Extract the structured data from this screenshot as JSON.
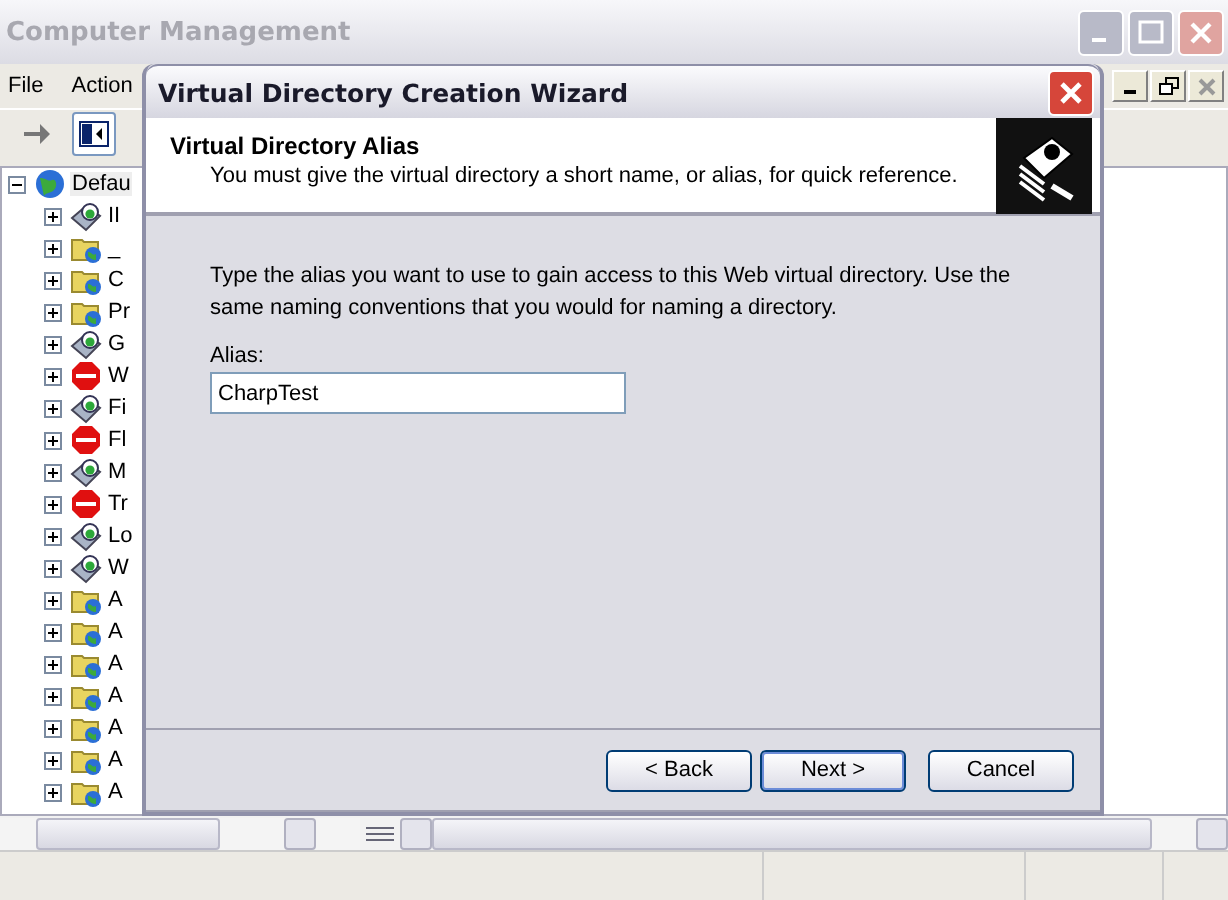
{
  "window": {
    "title": "Computer Management"
  },
  "menu": [
    "File",
    "Action"
  ],
  "tree": {
    "label": "Defau",
    "expanded": true,
    "selected": true,
    "kind": "site",
    "children": [
      {
        "label": "II",
        "kind": "site",
        "expanded": false,
        "selected": false
      },
      {
        "label": "_",
        "kind": "folder",
        "expanded": false,
        "selected": false
      },
      {
        "label": "C",
        "kind": "folder",
        "expanded": false,
        "selected": false
      },
      {
        "label": "Pr",
        "kind": "folder",
        "expanded": false,
        "selected": false
      },
      {
        "label": "G",
        "kind": "site",
        "expanded": false,
        "selected": false
      },
      {
        "label": "W",
        "kind": "error",
        "expanded": false,
        "selected": false
      },
      {
        "label": "Fi",
        "kind": "site",
        "expanded": false,
        "selected": false
      },
      {
        "label": "Fl",
        "kind": "error",
        "expanded": false,
        "selected": false
      },
      {
        "label": "M",
        "kind": "site",
        "expanded": false,
        "selected": false
      },
      {
        "label": "Tr",
        "kind": "error",
        "expanded": false,
        "selected": false
      },
      {
        "label": "Lo",
        "kind": "site",
        "expanded": false,
        "selected": false
      },
      {
        "label": "W",
        "kind": "site",
        "expanded": false,
        "selected": false
      },
      {
        "label": "A",
        "kind": "folder",
        "expanded": false,
        "selected": false
      },
      {
        "label": "A",
        "kind": "folder",
        "expanded": false,
        "selected": false
      },
      {
        "label": "A",
        "kind": "folder",
        "expanded": false,
        "selected": false
      },
      {
        "label": "A",
        "kind": "folder",
        "expanded": false,
        "selected": false
      },
      {
        "label": "A",
        "kind": "folder",
        "expanded": false,
        "selected": false
      },
      {
        "label": "A",
        "kind": "folder",
        "expanded": false,
        "selected": false
      },
      {
        "label": "A",
        "kind": "folder",
        "expanded": false,
        "selected": false
      }
    ]
  },
  "dialog": {
    "title": "Virtual Directory Creation Wizard",
    "heading": "Virtual Directory Alias",
    "subheading": "You must give the virtual directory a short name, or alias, for quick reference.",
    "instructions": "Type the alias you want to use to gain access to this Web virtual directory. Use the same naming conventions that you would for naming a directory.",
    "alias_label": "Alias:",
    "alias_value": "CharpTest",
    "buttons": [
      {
        "label": "< Back",
        "default": false
      },
      {
        "label": "Next >",
        "default": true
      },
      {
        "label": "Cancel",
        "default": false
      }
    ]
  }
}
